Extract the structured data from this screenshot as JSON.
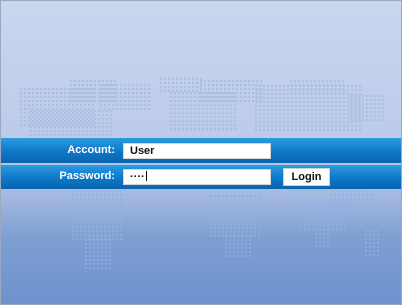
{
  "login": {
    "account_label": "Account:",
    "account_value": "User",
    "password_label": "Password:",
    "password_value": "····",
    "login_button": "Login"
  },
  "colors": {
    "band_top": "#2c9be0",
    "band_bottom": "#0a63ad",
    "background_top": "#c9d6ee",
    "background_bottom": "#6e92cd"
  },
  "icons": {
    "background": "world-map-dots"
  }
}
